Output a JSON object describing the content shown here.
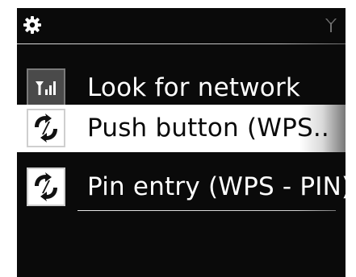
{
  "header": {
    "settings_icon": "gear-icon",
    "signal_icon": "antenna-icon"
  },
  "menu": {
    "items": [
      {
        "label": "Look for network",
        "icon": "signal-bars-icon",
        "selected": false
      },
      {
        "label": "Push button (WPS...",
        "icon": "wps-refresh-icon",
        "selected": true
      },
      {
        "label": "Pin entry (WPS - PIN)",
        "icon": "wps-refresh-icon",
        "selected": false
      }
    ]
  },
  "colors": {
    "background": "#0a0a0a",
    "text": "#ffffff",
    "selected_background": "#ffffff",
    "selected_text": "#0a0a0a"
  }
}
